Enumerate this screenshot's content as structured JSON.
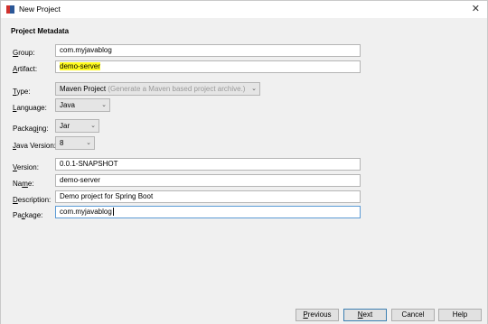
{
  "window": {
    "title": "New Project"
  },
  "section": {
    "title": "Project Metadata"
  },
  "fields": {
    "group": {
      "accel": "G",
      "rest": "roup:",
      "value": "com.myjavablog"
    },
    "artifact": {
      "accel": "A",
      "rest": "rtifact:",
      "value": "demo-server"
    },
    "type": {
      "accel": "T",
      "rest": "ype:",
      "value": "Maven Project",
      "hint": "(Generate a Maven based project archive.)"
    },
    "language": {
      "accel": "L",
      "rest": "anguage:",
      "value": "Java"
    },
    "packaging": {
      "pre": "Packag",
      "accel": "i",
      "rest": "ng:",
      "value": "Jar"
    },
    "java_version": {
      "accel": "J",
      "rest": "ava Version:",
      "value": "8"
    },
    "version": {
      "accel": "V",
      "rest": "ersion:",
      "value": "0.0.1-SNAPSHOT"
    },
    "name": {
      "pre": "Na",
      "accel": "m",
      "rest": "e:",
      "value": "demo-server"
    },
    "description": {
      "accel": "D",
      "rest": "escription:",
      "value": "Demo project for Spring Boot"
    },
    "package": {
      "pre": "Pa",
      "accel": "c",
      "rest": "kage:",
      "value": "com.myjavablog"
    }
  },
  "buttons": {
    "previous": {
      "pre": "",
      "accel": "P",
      "rest": "revious"
    },
    "next": {
      "pre": "",
      "accel": "N",
      "rest": "ext"
    },
    "cancel": {
      "label": "Cancel"
    },
    "help": {
      "label": "Help"
    }
  },
  "icons": {
    "close": "close-icon",
    "dropdown": "chevron-down-icon",
    "app": "app-icon"
  },
  "colors": {
    "highlight": "#fffb20",
    "focus_border": "#5b9bd5",
    "default_button_border": "#3c7fb1"
  }
}
